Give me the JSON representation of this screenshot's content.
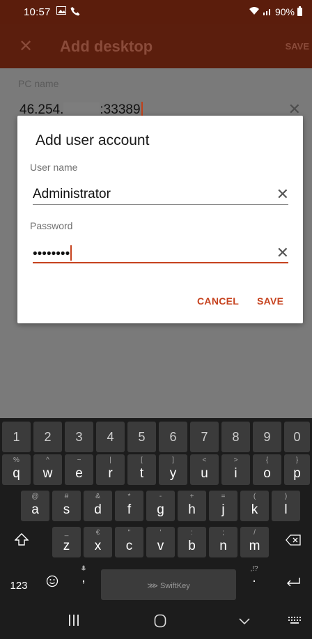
{
  "status_bar": {
    "time": "10:57",
    "battery": "90%"
  },
  "app_bar": {
    "title": "Add desktop",
    "save_label": "SAVE",
    "close_icon": "close-icon"
  },
  "background": {
    "pc_name_label": "PC name",
    "pc_name_prefix": "46.254.",
    "pc_name_suffix": ":33389"
  },
  "dialog": {
    "title": "Add user account",
    "username_label": "User name",
    "username_value": "Administrator",
    "password_label": "Password",
    "password_value": "••••••••",
    "cancel_label": "CANCEL",
    "save_label": "SAVE",
    "accent_color": "#c6421e"
  },
  "keyboard": {
    "number_row": [
      "1",
      "2",
      "3",
      "4",
      "5",
      "6",
      "7",
      "8",
      "9",
      "0"
    ],
    "row1": [
      {
        "k": "q",
        "h": "%"
      },
      {
        "k": "w",
        "h": "^"
      },
      {
        "k": "e",
        "h": "~"
      },
      {
        "k": "r",
        "h": "|"
      },
      {
        "k": "t",
        "h": "["
      },
      {
        "k": "y",
        "h": "]"
      },
      {
        "k": "u",
        "h": "<"
      },
      {
        "k": "i",
        "h": ">"
      },
      {
        "k": "o",
        "h": "{"
      },
      {
        "k": "p",
        "h": "}"
      }
    ],
    "row2": [
      {
        "k": "a",
        "h": "@"
      },
      {
        "k": "s",
        "h": "#"
      },
      {
        "k": "d",
        "h": "&"
      },
      {
        "k": "f",
        "h": "*"
      },
      {
        "k": "g",
        "h": "-"
      },
      {
        "k": "h",
        "h": "+"
      },
      {
        "k": "j",
        "h": "="
      },
      {
        "k": "k",
        "h": "("
      },
      {
        "k": "l",
        "h": ")"
      }
    ],
    "row3": [
      {
        "k": "z",
        "h": "_"
      },
      {
        "k": "x",
        "h": "€"
      },
      {
        "k": "c",
        "h": "\""
      },
      {
        "k": "v",
        "h": "'"
      },
      {
        "k": "b",
        "h": ":"
      },
      {
        "k": "n",
        "h": ";"
      },
      {
        "k": "m",
        "h": "/"
      }
    ],
    "num_switch": "123",
    "comma": ",",
    "period": ".",
    "period_hint": ",!?",
    "space_label": "SwiftKey",
    "shift_icon": "shift-icon",
    "backspace_icon": "backspace-icon",
    "emoji_icon": "emoji-icon",
    "enter_icon": "enter-icon"
  },
  "nav_bar": {
    "recents_icon": "recents-icon",
    "home_icon": "home-icon",
    "back_icon": "back-icon",
    "keyboard_icon": "keyboard-hide-icon"
  }
}
